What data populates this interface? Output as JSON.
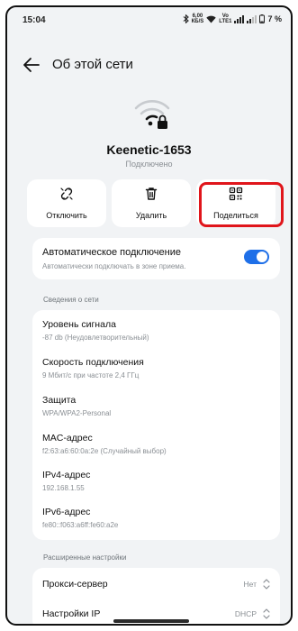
{
  "status_bar": {
    "time": "15:04",
    "net_speed_value": "6,00",
    "net_speed_unit": "КБ/S",
    "volte_top": "Vo",
    "volte_bottom": "LTE1",
    "lte_badge": "LTE",
    "battery": "7 %"
  },
  "header": {
    "title": "Об этой сети"
  },
  "network": {
    "name": "Keenetic-1653",
    "status": "Подключено"
  },
  "actions": {
    "disconnect": "Отключить",
    "delete": "Удалить",
    "share": "Поделиться"
  },
  "auto_connect": {
    "title": "Автоматическое подключение",
    "subtitle": "Автоматически подключать в зоне приема.",
    "enabled": true
  },
  "details": {
    "section": "Сведения о сети",
    "rows": [
      {
        "key": "Уровень сигнала",
        "value": "-87 db (Неудовлетворительный)"
      },
      {
        "key": "Скорость подключения",
        "value": "9 Мбит/с при частоте 2,4 ГГц"
      },
      {
        "key": "Защита",
        "value": "WPA/WPA2-Personal"
      },
      {
        "key": "MAC-адрес",
        "value": "f2:63:a6:60:0a:2e (Случайный выбор)"
      },
      {
        "key": "IPv4-адрес",
        "value": "192.168.1.55"
      },
      {
        "key": "IPv6-адрес",
        "value": "fe80::f063:a6ff:fe60:a2e"
      }
    ]
  },
  "advanced": {
    "section": "Расширенные настройки",
    "rows": [
      {
        "key": "Прокси-сервер",
        "value": "Нет"
      },
      {
        "key": "Настройки IP",
        "value": "DHCP"
      }
    ]
  },
  "colors": {
    "accent": "#1e6fe8",
    "highlight": "#e0151b",
    "background": "#f1f3f5"
  }
}
